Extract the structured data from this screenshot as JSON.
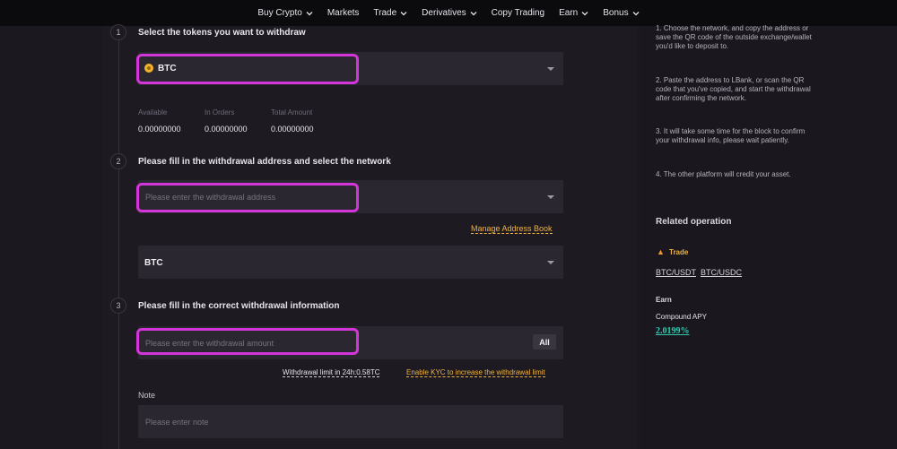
{
  "nav": {
    "items": [
      {
        "label": "Buy Crypto",
        "has_dropdown": true
      },
      {
        "label": "Markets",
        "has_dropdown": false
      },
      {
        "label": "Trade",
        "has_dropdown": true
      },
      {
        "label": "Derivatives",
        "has_dropdown": true
      },
      {
        "label": "Copy Trading",
        "has_dropdown": false
      },
      {
        "label": "Earn",
        "has_dropdown": true
      },
      {
        "label": "Bonus",
        "has_dropdown": true
      }
    ]
  },
  "steps": {
    "s1": {
      "number": "1",
      "title": "Select the tokens you want to withdraw"
    },
    "s2": {
      "number": "2",
      "title": "Please fill in the withdrawal address and select the network"
    },
    "s3": {
      "number": "3",
      "title": "Please fill in the correct withdrawal information"
    }
  },
  "token_select": {
    "value": "BTC",
    "icon": "btc-coin-icon"
  },
  "balances": {
    "available_label": "Available",
    "available_value": "0.00000000",
    "in_orders_label": "In Orders",
    "in_orders_value": "0.00000000",
    "total_label": "Total Amount",
    "total_value": "0.00000000"
  },
  "address": {
    "placeholder": "Please enter the withdrawal address"
  },
  "manage_address_book": "Manage Address Book",
  "network_select": {
    "value": "BTC"
  },
  "amount": {
    "placeholder": "Please enter the withdrawal amount",
    "all_label": "All"
  },
  "limit_text": "Withdrawal limit in 24h:0.58TC",
  "kyc_link": "Enable KYC to increase the withdrawal limit",
  "note": {
    "label": "Note",
    "placeholder": "Please enter note"
  },
  "tips": [
    "1. Choose the network, and copy the address or save the QR code of the outside exchange/wallet you'd like to deposit to.",
    "2. Paste the address to LBank, or scan the QR code that you've copied, and start the withdrawal after confirming the network.",
    "3. It will take some time for the block to confirm your withdrawal info, please wait patiently.",
    "4. The other platform will credit your asset."
  ],
  "related": {
    "title": "Related operation",
    "trade_label": "Trade",
    "pairs": [
      "BTC/USDT",
      "BTC/USDC"
    ],
    "earn_label": "Earn",
    "compound_label": "Compound APY",
    "apy_value": "2.0199%"
  },
  "colors": {
    "highlight": "#d435d8",
    "accent_yellow": "#f0b341",
    "accent_teal": "#2ecbb0"
  }
}
